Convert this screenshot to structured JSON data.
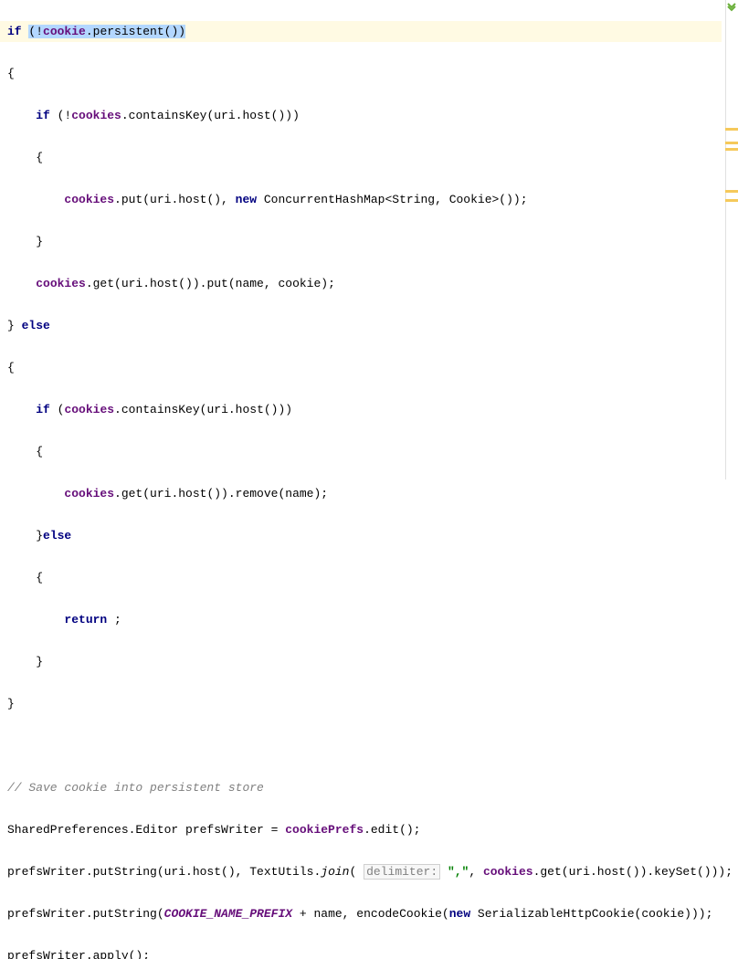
{
  "code": {
    "kw_if": "if",
    "kw_else": "else",
    "kw_new": "new",
    "kw_return": "return",
    "sel_open": "(!",
    "sel_cookie": "cookie",
    "sel_dot_persistent": ".persistent())",
    "l1_open": "{",
    "l2_if": "if",
    "l2_rest": " (!",
    "l2_fld": "cookies",
    "l2_b": ".containsKey(uri.host()))",
    "l3_open": "{",
    "l4_a": "cookies",
    "l4_b": ".put(uri.host(), ",
    "l4_c": " ConcurrentHashMap<String, Cookie>());",
    "l5_close": "}",
    "l6_a": "cookies",
    "l6_b": ".get(uri.host()).put(name, cookie);",
    "l7_a": "} ",
    "l8_open": "{",
    "l9_if": "if",
    "l9_a": " (",
    "l9_fld": "cookies",
    "l9_b": ".containsKey(uri.host()))",
    "l10_open": "{",
    "l11_a": "cookies",
    "l11_b": ".get(uri.host()).remove(name);",
    "l12_a": "}",
    "l13_open": "{",
    "l14_ret": "return",
    "l14_semi": " ;",
    "l15_close": "}",
    "l16_close": "}",
    "comment": "// Save cookie into persistent store",
    "l18_a": "SharedPreferences.Editor prefsWriter = ",
    "l18_b": "cookiePrefs",
    "l18_c": ".edit();",
    "l19_a": "prefsWriter.putString(uri.host(), TextUtils.",
    "l19_join": "join",
    "l19_b": "(",
    "hint_label": "delimiter:",
    "l19_str": "\",\"",
    "l19_c": ", ",
    "l19_fld": "cookies",
    "l19_d": ".get(uri.host()).keySet()));",
    "l20_a": "prefsWriter.putString(",
    "l20_const": "COOKIE_NAME_PREFIX",
    "l20_b": " + name, encodeCookie(",
    "l20_c": " SerializableHttpCookie(cookie)));",
    "l21": "prefsWriter.apply();"
  }
}
